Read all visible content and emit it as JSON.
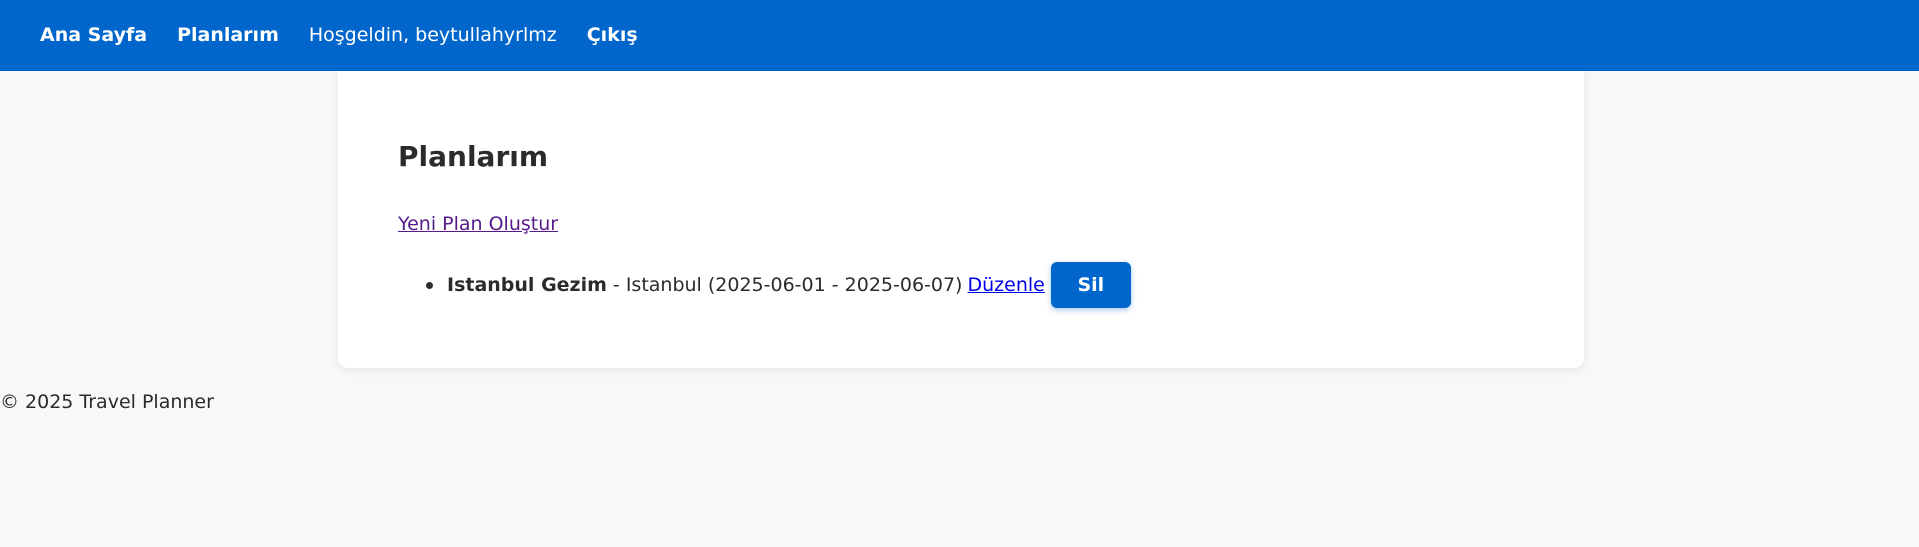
{
  "nav": {
    "home": "Ana Sayfa",
    "plans": "Planlarım",
    "welcome": "Hoşgeldin, beytullahyrlmz",
    "logout": "Çıkış"
  },
  "main": {
    "title": "Planlarım",
    "new_plan_link": "Yeni Plan Oluştur",
    "plans": [
      {
        "name": "Istanbul Gezim",
        "details": "- Istanbul (2025-06-01 - 2025-06-07)",
        "edit_label": "Düzenle",
        "delete_label": "Sil"
      }
    ]
  },
  "footer": {
    "text": "© 2025 Travel Planner"
  },
  "colors": {
    "primary": "#0066cc",
    "background": "#f8f8f8",
    "card": "#ffffff",
    "visited_link": "#551a8b",
    "link": "#0000ee"
  }
}
